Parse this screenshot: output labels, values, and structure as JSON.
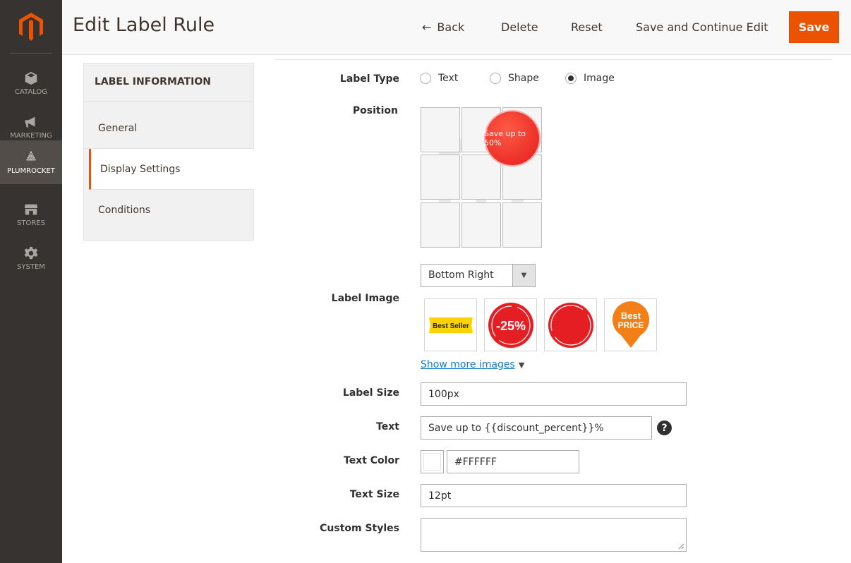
{
  "nav": {
    "items": [
      {
        "label": "CATALOG",
        "icon": "catalog-icon"
      },
      {
        "label": "MARKETING",
        "icon": "megaphone-icon"
      },
      {
        "label": "PLUMROCKET",
        "icon": "plumrocket-icon"
      },
      {
        "label": "STORES",
        "icon": "store-icon"
      },
      {
        "label": "SYSTEM",
        "icon": "gear-icon"
      }
    ],
    "active": "PLUMROCKET"
  },
  "header": {
    "title": "Edit Label Rule",
    "back": "Back",
    "delete": "Delete",
    "reset": "Reset",
    "save_continue": "Save and Continue Edit",
    "save": "Save"
  },
  "tabs": {
    "title": "LABEL INFORMATION",
    "items": [
      "General",
      "Display Settings",
      "Conditions"
    ],
    "active": "Display Settings"
  },
  "form": {
    "label_type": {
      "label": "Label Type",
      "options": [
        "Text",
        "Shape",
        "Image"
      ],
      "selected": "Image"
    },
    "position": {
      "label": "Position",
      "preview_text": "Save up to 50%",
      "select_value": "Bottom Right"
    },
    "label_image": {
      "label": "Label Image",
      "images": [
        {
          "name": "best-seller-image",
          "text": "Best Seller"
        },
        {
          "name": "minus-25-percent-image",
          "text": "-25%"
        },
        {
          "name": "red-circle-image",
          "text": ""
        },
        {
          "name": "best-price-image",
          "text": "Best PRICE",
          "line1": "Best",
          "line2": "PRICE"
        }
      ],
      "more_link": "Show more images"
    },
    "label_size": {
      "label": "Label Size",
      "value": "100px"
    },
    "text": {
      "label": "Text",
      "value": "Save up to {{discount_percent}}%"
    },
    "text_color": {
      "label": "Text Color",
      "value": "#FFFFFF"
    },
    "text_size": {
      "label": "Text Size",
      "value": "12pt"
    },
    "custom_styles": {
      "label": "Custom Styles",
      "value": ""
    }
  },
  "colors": {
    "accent": "#eb5202",
    "nav_bg": "#373330",
    "badge_red": "#e2191b",
    "link": "#1979c3"
  }
}
